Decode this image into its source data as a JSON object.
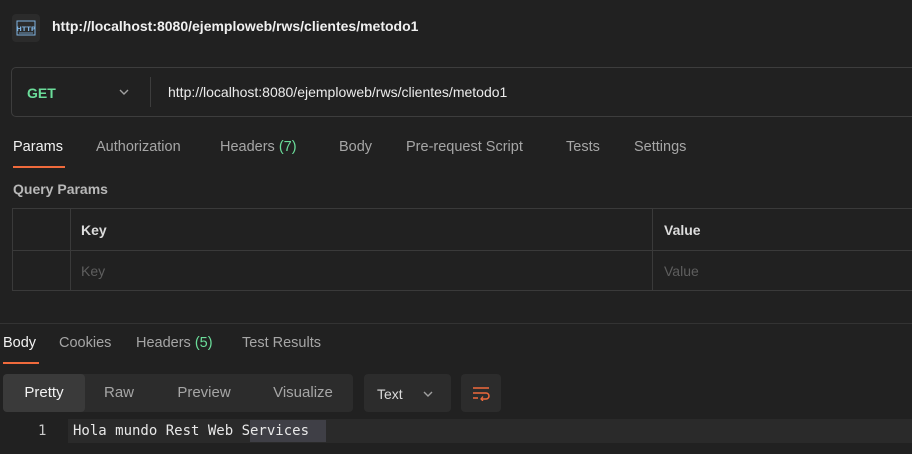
{
  "request_title": "http://localhost:8080/ejemploweb/rws/clientes/metodo1",
  "title_icon": "http-icon",
  "method": "GET",
  "url": "http://localhost:8080/ejemploweb/rws/clientes/metodo1",
  "request_tabs": {
    "params": "Params",
    "authorization": "Authorization",
    "headers": "Headers",
    "headers_count": "(7)",
    "body": "Body",
    "prerequest": "Pre-request Script",
    "tests": "Tests",
    "settings": "Settings"
  },
  "query_params": {
    "label": "Query Params",
    "columns": [
      "Key",
      "Value"
    ],
    "placeholders": [
      "Key",
      "Value"
    ]
  },
  "response_tabs": {
    "body": "Body",
    "cookies": "Cookies",
    "headers": "Headers",
    "headers_count": "(5)",
    "test_results": "Test Results"
  },
  "format": {
    "modes": [
      "Pretty",
      "Raw",
      "Preview",
      "Visualize"
    ],
    "selected": "Pretty",
    "type": "Text"
  },
  "response_body": {
    "line_number": "1",
    "line": "Hola mundo Rest Web Services"
  },
  "colors": {
    "accent": "#f06a3c",
    "method_get": "#6bdd9a",
    "count": "#6bdd9a"
  }
}
